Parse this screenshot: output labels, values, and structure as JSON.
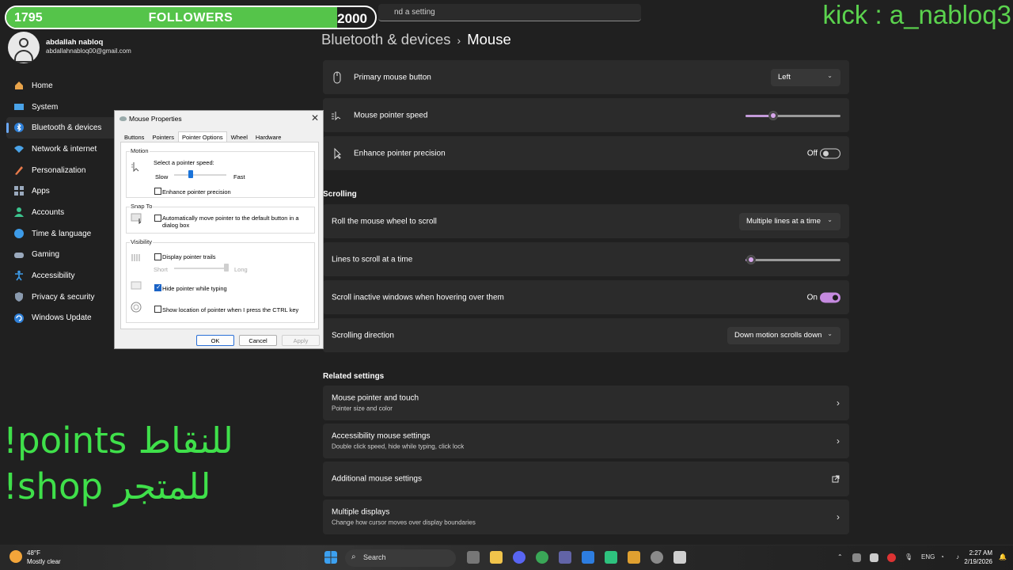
{
  "overlay": {
    "followers_current": "1795",
    "followers_label": "FOLLOWERS",
    "followers_goal": "2000",
    "followers_progress": 0.8975,
    "kick_handle": "kick : a_nabloq3",
    "promo_points": "!points للنقاط",
    "promo_shop": "!shop للمتجر"
  },
  "search": {
    "placeholder": "Find a setting",
    "visible_text": "nd a setting"
  },
  "user": {
    "name": "abdallah nabloq",
    "email": "abdallahnabloq00@gmail.com"
  },
  "nav": [
    {
      "label": "Home",
      "icon": "home-icon"
    },
    {
      "label": "System",
      "icon": "system-icon"
    },
    {
      "label": "Bluetooth & devices",
      "icon": "bluetooth-icon",
      "active": true
    },
    {
      "label": "Network & internet",
      "icon": "wifi-icon"
    },
    {
      "label": "Personalization",
      "icon": "brush-icon"
    },
    {
      "label": "Apps",
      "icon": "apps-icon"
    },
    {
      "label": "Accounts",
      "icon": "account-icon"
    },
    {
      "label": "Time & language",
      "icon": "globe-icon"
    },
    {
      "label": "Gaming",
      "icon": "gamepad-icon"
    },
    {
      "label": "Accessibility",
      "icon": "accessibility-icon"
    },
    {
      "label": "Privacy & security",
      "icon": "shield-icon"
    },
    {
      "label": "Windows Update",
      "icon": "update-icon"
    }
  ],
  "breadcrumb": {
    "parent": "Bluetooth & devices",
    "separator": "›",
    "current": "Mouse"
  },
  "mouse": {
    "primary_button": {
      "label": "Primary mouse button",
      "value": "Left"
    },
    "pointer_speed": {
      "label": "Mouse pointer speed",
      "level": 0.29
    },
    "precision": {
      "label": "Enhance pointer precision",
      "state": "Off"
    }
  },
  "scrolling": {
    "heading": "Scrolling",
    "roll": {
      "label": "Roll the mouse wheel to scroll",
      "value": "Multiple lines at a time"
    },
    "lines": {
      "label": "Lines to scroll at a time",
      "level": 0.06
    },
    "inactive": {
      "label": "Scroll inactive windows when hovering over them",
      "state": "On"
    },
    "direction": {
      "label": "Scrolling direction",
      "value": "Down motion scrolls down"
    }
  },
  "related": {
    "heading": "Related settings",
    "items": [
      {
        "title": "Mouse pointer and touch",
        "sub": "Pointer size and color"
      },
      {
        "title": "Accessibility mouse settings",
        "sub": "Double click speed, hide while typing, click lock"
      },
      {
        "title": "Additional mouse settings",
        "sub": ""
      },
      {
        "title": "Multiple displays",
        "sub": "Change how cursor moves over display boundaries"
      }
    ]
  },
  "dialog": {
    "title": "Mouse Properties",
    "tabs": [
      "Buttons",
      "Pointers",
      "Pointer Options",
      "Wheel",
      "Hardware"
    ],
    "selected_tab": "Pointer Options",
    "motion": {
      "group": "Motion",
      "speed_label": "Select a pointer speed:",
      "slow": "Slow",
      "fast": "Fast",
      "speed_level": 0.32,
      "precision_label": "Enhance pointer precision",
      "precision_checked": false
    },
    "snap": {
      "group": "Snap To",
      "label": "Automatically move pointer to the default button in a dialog box",
      "line1": "Automatically move pointer to the default button in a",
      "line2": "dialog box",
      "checked": false
    },
    "visibility": {
      "group": "Visibility",
      "trails_label": "Display pointer trails",
      "trails_checked": false,
      "short": "Short",
      "long": "Long",
      "trails_level": 1.0,
      "hide_label": "Hide pointer while typing",
      "hide_checked": true,
      "ctrl_label": "Show location of pointer when I press the CTRL key",
      "ctrl_checked": false
    },
    "buttons": {
      "ok": "OK",
      "cancel": "Cancel",
      "apply": "Apply"
    }
  },
  "taskbar": {
    "temp": "48°F",
    "weather": "Mostly clear",
    "search": "Search",
    "lang": "ENG",
    "time": "2:27 AM",
    "date": "2/19/2026"
  },
  "colors": {
    "accent": "#c58adf",
    "progress": "#55c44a",
    "kick": "#5bd34e"
  }
}
